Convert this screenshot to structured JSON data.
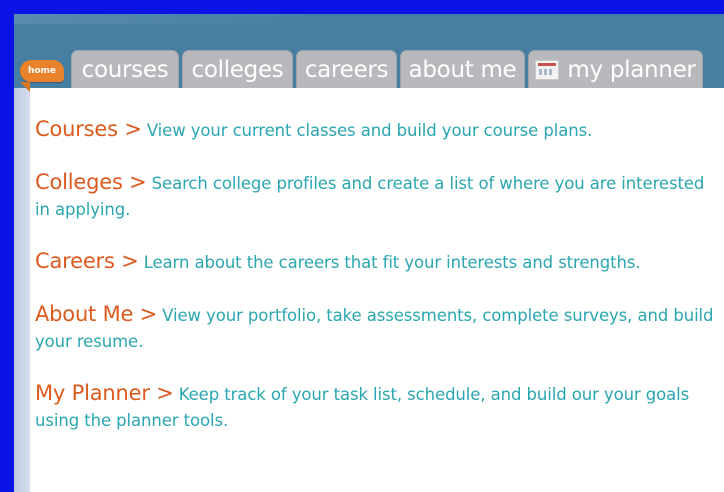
{
  "nav": {
    "home_label": "home",
    "tabs": [
      {
        "label": "courses"
      },
      {
        "label": "colleges"
      },
      {
        "label": "careers"
      },
      {
        "label": "about me"
      },
      {
        "label": "my planner",
        "icon": "calendar-icon"
      }
    ]
  },
  "sections": [
    {
      "title": "Courses >",
      "description": "View your current classes and build your course plans."
    },
    {
      "title": "Colleges >",
      "description": "Search college profiles and create a list of where you are interested in applying."
    },
    {
      "title": "Careers >",
      "description": "Learn about the careers that fit your interests and strengths."
    },
    {
      "title": "About Me >",
      "description": "View your portfolio, take assessments, complete surveys, and build your resume."
    },
    {
      "title": "My Planner >",
      "description": "Keep track of your task list, schedule, and build our your goals using the planner tools."
    }
  ],
  "colors": {
    "frame": "#0a14e6",
    "header": "#467fa2",
    "tab": "#b7b9bc",
    "home_tab": "#e8822b",
    "title": "#dc5a1e",
    "description": "#2aa6b0"
  }
}
